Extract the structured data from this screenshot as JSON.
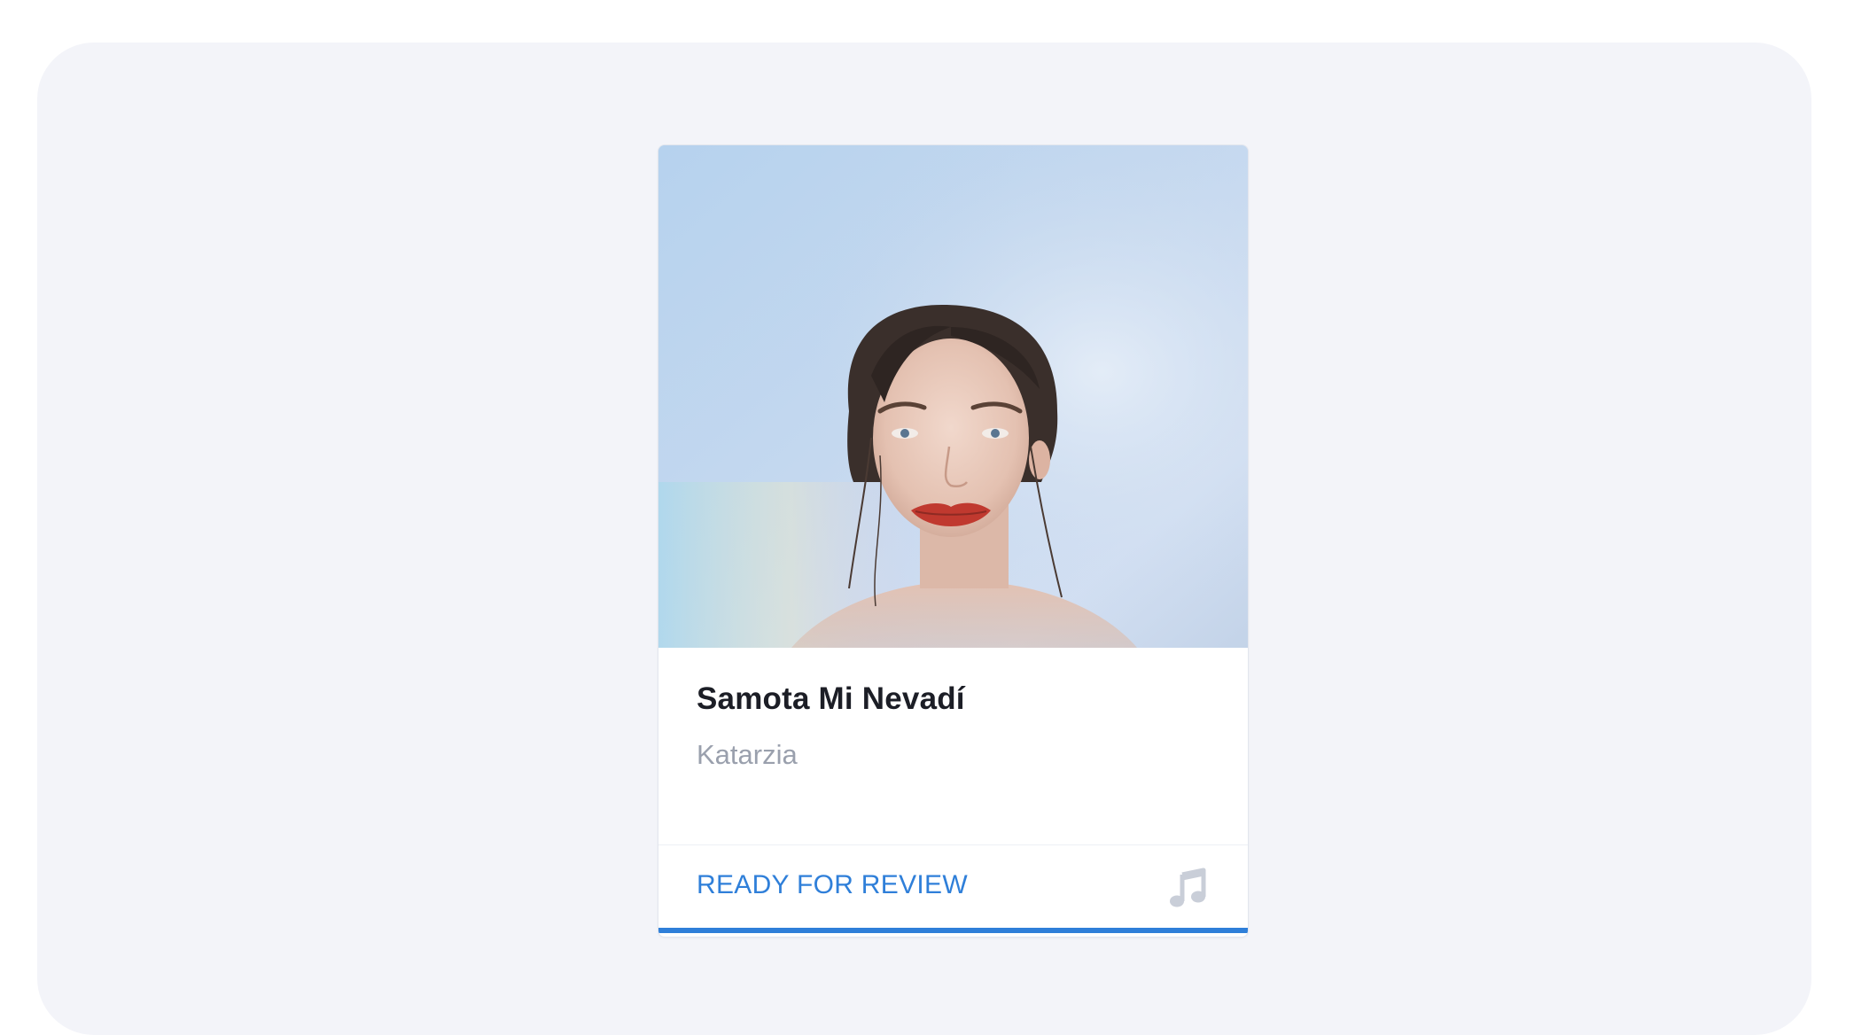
{
  "card": {
    "title": "Samota Mi Nevadí",
    "artist": "Katarzia",
    "status": "READY FOR REVIEW",
    "status_color": "#2f7fd9",
    "cover_icon": "cover-art-image",
    "type_icon": "music-note-icon"
  },
  "colors": {
    "panel_background": "#f3f4f9",
    "card_background": "#ffffff",
    "title_text": "#1c1e26",
    "artist_text": "#9aa0ad",
    "accent": "#2f7fd9"
  }
}
